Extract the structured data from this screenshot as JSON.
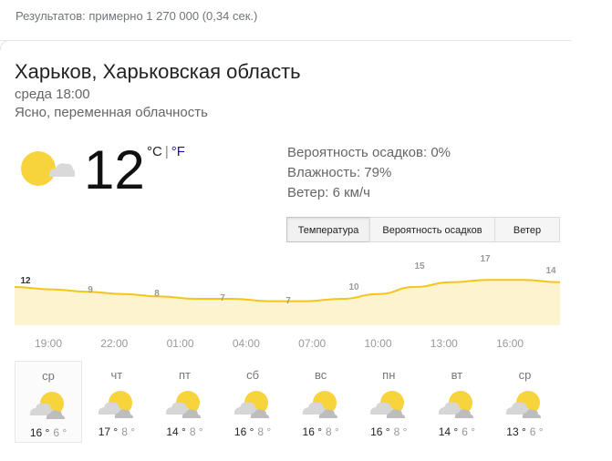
{
  "search": {
    "results_text": "Результатов: примерно 1 270 000 (0,34 сек.)"
  },
  "weather": {
    "location": "Харьков, Харьковская область",
    "datetime": "среда 18:00",
    "condition": "Ясно, переменная облачность",
    "temperature": "12",
    "unit_c": "°C",
    "unit_sep": "|",
    "unit_f": "°F",
    "precip": "Вероятность осадков: 0%",
    "humidity": "Влажность: 79%",
    "wind": "Ветер: 6 км/ч",
    "current_icon": "partly-sunny-icon",
    "accent_color": "#f5c518",
    "fill_color": "#fdf3cf"
  },
  "tabs": [
    {
      "label": "Температура",
      "active": true
    },
    {
      "label": "Вероятность осадков",
      "active": false
    },
    {
      "label": "Ветер",
      "active": false
    }
  ],
  "chart_data": {
    "type": "area",
    "times": [
      "19:00",
      "22:00",
      "01:00",
      "04:00",
      "07:00",
      "10:00",
      "13:00",
      "16:00"
    ],
    "label_values": [
      "12",
      "9",
      "8",
      "7",
      "7",
      "10",
      "15",
      "17",
      "14"
    ],
    "values": [
      12,
      11,
      10,
      9,
      8,
      7,
      7,
      6,
      6,
      7,
      9,
      12,
      14,
      15,
      15,
      14
    ],
    "ylim": [
      0,
      20
    ]
  },
  "forecast": [
    {
      "day": "ср",
      "high": "16 °",
      "low": "6 °",
      "icon": "partly-cloudy-icon",
      "active": true
    },
    {
      "day": "чт",
      "high": "17 °",
      "low": "8 °",
      "icon": "partly-cloudy-icon"
    },
    {
      "day": "пт",
      "high": "14 °",
      "low": "8 °",
      "icon": "partly-cloudy-icon"
    },
    {
      "day": "сб",
      "high": "16 °",
      "low": "8 °",
      "icon": "partly-cloudy-icon"
    },
    {
      "day": "вс",
      "high": "16 °",
      "low": "8 °",
      "icon": "partly-cloudy-icon"
    },
    {
      "day": "пн",
      "high": "16 °",
      "low": "8 °",
      "icon": "partly-cloudy-icon"
    },
    {
      "day": "вт",
      "high": "14 °",
      "low": "6 °",
      "icon": "partly-cloudy-icon"
    },
    {
      "day": "ср",
      "high": "13 °",
      "low": "6 °",
      "icon": "partly-cloudy-icon"
    }
  ]
}
